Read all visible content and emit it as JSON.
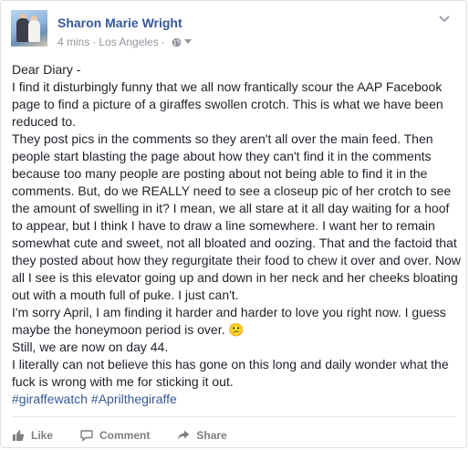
{
  "post": {
    "author": "Sharon Marie Wright",
    "time": "4 mins",
    "separator": "·",
    "location": "Los Angeles",
    "separator2": "·",
    "body": [
      "Dear Diary -",
      "I find it disturbingly funny that we all now frantically scour the AAP Facebook page to find a picture of a giraffes swollen crotch. This is what we have been reduced to.",
      "They post pics in the comments so they aren't all over the main feed. Then people start blasting the page about how they can't find it in the comments because too many people are posting about not being able to find it in the comments. But, do we REALLY need to see a closeup pic of her crotch to see the amount of swelling in it? I mean, we all stare at it all day waiting for a hoof to appear, but I think I have to draw a line somewhere. I want her to remain somewhat cute and sweet, not all bloated and oozing. That and the factoid that they posted about how they regurgitate their food to chew it over and over. Now all I see is this elevator going up and down in her neck and her cheeks bloating out with a mouth full of puke. I just can't.",
      "I'm sorry April, I am finding it harder and harder to love you right now. I guess maybe the honeymoon period is over. 😕",
      "Still, we are now on day 44.",
      "I literally can not believe this has gone on this long and daily wonder what the fuck is wrong with me for sticking it out."
    ],
    "hashtags": [
      "#giraffewatch",
      "#Aprilthegiraffe"
    ]
  },
  "actions": {
    "like": "Like",
    "comment": "Comment",
    "share": "Share"
  },
  "icons": {
    "globe": "globe-icon",
    "audience_caret": "caret-down-icon",
    "options": "chevron-down-icon",
    "like": "thumbs-up-icon",
    "comment": "comment-icon",
    "share": "share-arrow-icon"
  },
  "colors": {
    "link": "#365899",
    "meta": "#90949c",
    "text": "#1d2129",
    "action": "#7f7f7f"
  }
}
